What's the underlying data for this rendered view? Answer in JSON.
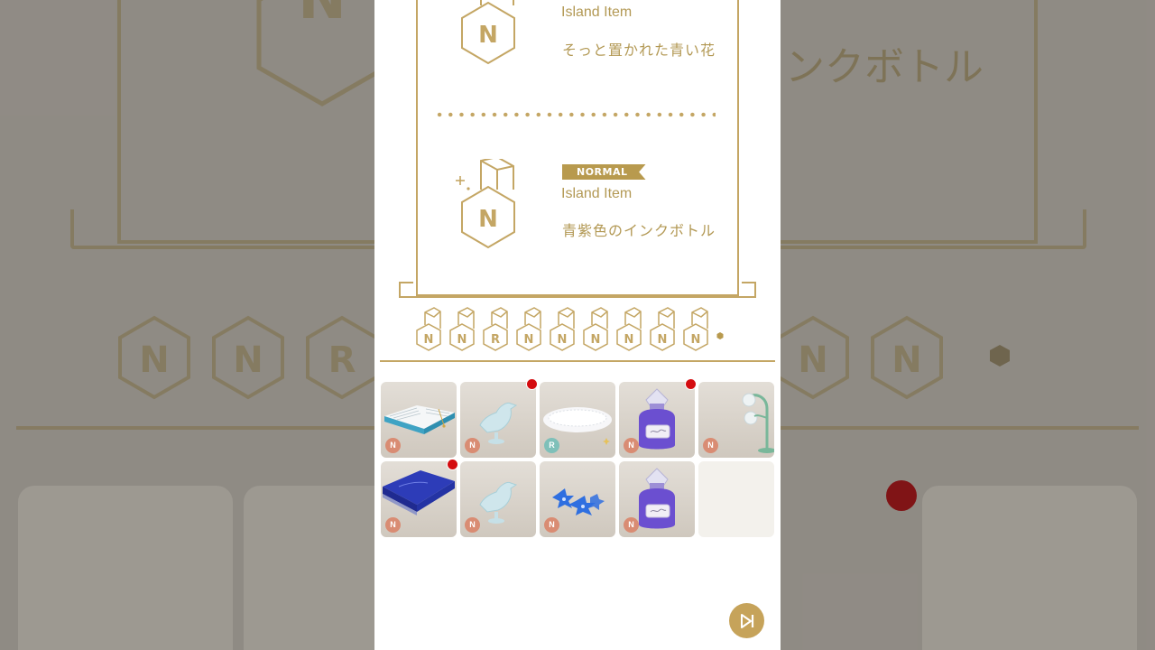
{
  "background": {
    "large_text": "ンクボトル"
  },
  "rewards": [
    {
      "rarity_letter": "N",
      "tag": "",
      "type": "Island Item",
      "name": "そっと置かれた青い花"
    },
    {
      "rarity_letter": "N",
      "tag": "NORMAL",
      "type": "Island Item",
      "name": "青紫色のインクボトル"
    }
  ],
  "rarity_row": [
    "N",
    "N",
    "R",
    "N",
    "N",
    "N",
    "N",
    "N",
    "N"
  ],
  "items": [
    {
      "name": "open-book",
      "rarity": "N",
      "new": false
    },
    {
      "name": "glass-bird",
      "rarity": "N",
      "new": true
    },
    {
      "name": "fur-cushion",
      "rarity": "R",
      "new": false
    },
    {
      "name": "purple-ink-bottle",
      "rarity": "N",
      "new": true
    },
    {
      "name": "lily-of-the-valley-lamp",
      "rarity": "N",
      "new": false
    },
    {
      "name": "blue-notebook",
      "rarity": "N",
      "new": true
    },
    {
      "name": "glass-bird",
      "rarity": "N",
      "new": false
    },
    {
      "name": "blue-flower",
      "rarity": "N",
      "new": false
    },
    {
      "name": "purple-ink-bottle",
      "rarity": "N",
      "new": false
    },
    {
      "name": "empty-slot",
      "rarity": "",
      "new": false
    }
  ],
  "colors": {
    "gold": "#c4a664",
    "badge_n": "#d98c73",
    "badge_r": "#7fc0b9",
    "new_dot": "#d40c10"
  },
  "skip_button": {
    "icon": "skip-forward-icon"
  }
}
